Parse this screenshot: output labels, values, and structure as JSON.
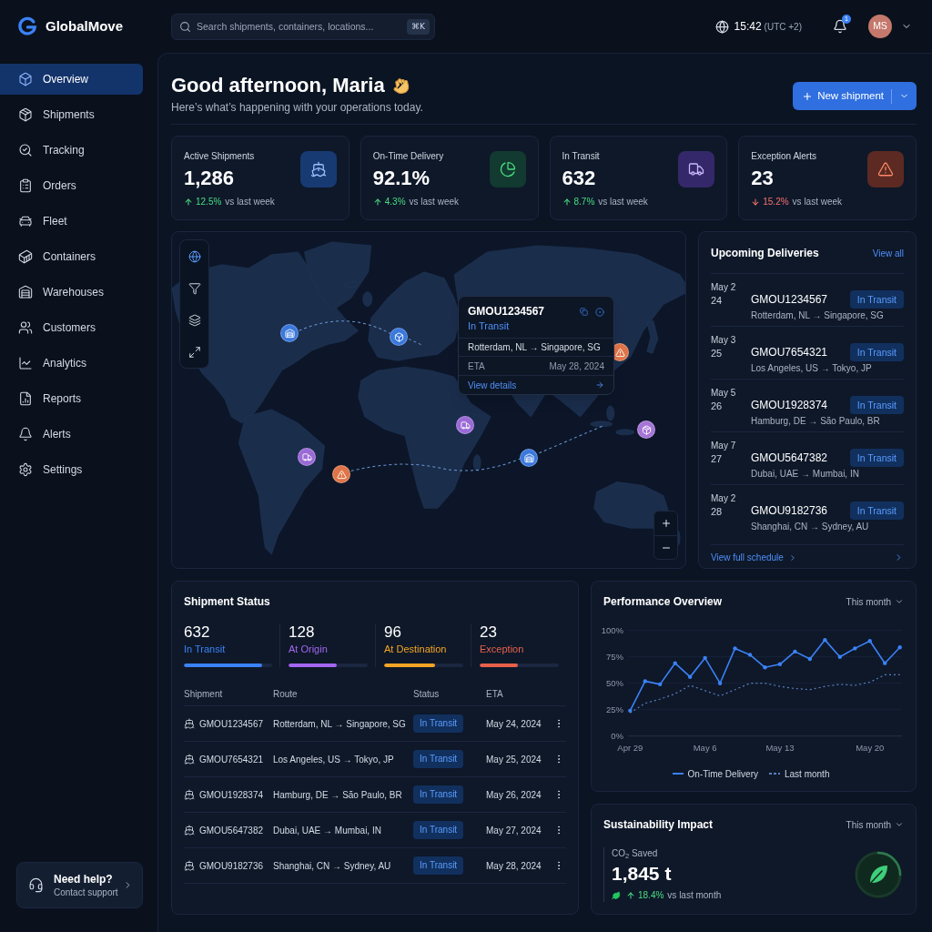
{
  "brand": {
    "name": "GlobalMove"
  },
  "search": {
    "placeholder": "Search shipments, containers, locations...",
    "shortcut": "⌘K"
  },
  "clock": {
    "time": "15:42",
    "zone": "(UTC +2)"
  },
  "notifications": {
    "count": "1"
  },
  "user": {
    "initials": "MS"
  },
  "sidebar": {
    "items": [
      {
        "label": "Overview",
        "selected": true
      },
      {
        "label": "Shipments",
        "selected": false
      },
      {
        "label": "Tracking",
        "selected": false
      },
      {
        "label": "Orders",
        "selected": false
      },
      {
        "label": "Fleet",
        "selected": false
      },
      {
        "label": "Containers",
        "selected": false
      },
      {
        "label": "Warehouses",
        "selected": false
      },
      {
        "label": "Customers",
        "selected": false
      },
      {
        "label": "Analytics",
        "selected": false
      },
      {
        "label": "Reports",
        "selected": false
      },
      {
        "label": "Alerts",
        "selected": false
      },
      {
        "label": "Settings",
        "selected": false
      }
    ],
    "help": {
      "title": "Need help?",
      "subtitle": "Contact support"
    }
  },
  "greeting": {
    "title": "Good afternoon, Maria",
    "subtitle": "Here’s what’s happening with your operations today."
  },
  "primary_action": {
    "label": "New shipment"
  },
  "kpis": [
    {
      "kind": "shipments",
      "label": "Active Shipments",
      "value": "1,286",
      "positive": true,
      "change": "12.5%",
      "note": "vs last week"
    },
    {
      "kind": "ontime",
      "label": "On-Time Delivery",
      "value": "92.1%",
      "positive": true,
      "change": "4.3%",
      "note": "vs last week"
    },
    {
      "kind": "transit",
      "label": "In Transit",
      "value": "632",
      "positive": true,
      "change": "8.7%",
      "note": "vs last week"
    },
    {
      "kind": "alert",
      "label": "Exception Alerts",
      "value": "23",
      "positive": false,
      "change": "15.2%",
      "note": "vs last week"
    }
  ],
  "map": {
    "tools": [
      {
        "selected": true
      },
      {
        "selected": false
      },
      {
        "selected": false
      },
      {
        "selected": false
      }
    ],
    "popup": {
      "id": "GMOU1234567",
      "status": "In Transit",
      "route": "Rotterdam, NL → Singapore, SG",
      "eta_label": "ETA",
      "eta": "May 28, 2024",
      "link": "View details"
    }
  },
  "upcoming": {
    "title": "Upcoming Deliveries",
    "link": "View all",
    "items": [
      {
        "month": "May 2",
        "day": "24",
        "id": "GMOU1234567",
        "route": "Rotterdam, NL → Singapore, SG",
        "status": "In Transit"
      },
      {
        "month": "May 3",
        "day": "25",
        "id": "GMOU7654321",
        "route": "Los Angeles, US → Tokyo, JP",
        "status": "In Transit"
      },
      {
        "month": "May 5",
        "day": "26",
        "id": "GMOU1928374",
        "route": "Hamburg, DE → São Paulo, BR",
        "status": "In Transit"
      },
      {
        "month": "May 7",
        "day": "27",
        "id": "GMOU5647382",
        "route": "Dubai, UAE → Mumbai, IN",
        "status": "In Transit"
      },
      {
        "month": "May 2",
        "day": "28",
        "id": "GMOU9182736",
        "route": "Shanghai, CN → Sydney, AU",
        "status": "In Transit"
      }
    ],
    "footer_link": "View full schedule"
  },
  "shipment_status": {
    "title": "Shipment Status",
    "stats": [
      {
        "value": "632",
        "label": "In Transit",
        "color": "#3b82f6",
        "level": 0.89
      },
      {
        "value": "128",
        "label": "At Origin",
        "color": "#a366f0",
        "level": 0.61
      },
      {
        "value": "96",
        "label": "At Destination",
        "color": "#f5a524",
        "level": 0.64
      },
      {
        "value": "23",
        "label": "Exception",
        "color": "#e8604a",
        "level": 0.48
      }
    ],
    "table": {
      "columns": [
        "Shipment",
        "Route",
        "Status",
        "ETA"
      ],
      "rows": [
        {
          "id": "GMOU1234567",
          "route": "Rotterdam, NL → Singapore, SG",
          "status": "In Transit",
          "eta": "May 24, 2024"
        },
        {
          "id": "GMOU7654321",
          "route": "Los Angeles, US → Tokyo, JP",
          "status": "In Transit",
          "eta": "May 25, 2024"
        },
        {
          "id": "GMOU1928374",
          "route": "Hamburg, DE → São Paulo, BR",
          "status": "In Transit",
          "eta": "May 26, 2024"
        },
        {
          "id": "GMOU5647382",
          "route": "Dubai, UAE → Mumbai, IN",
          "status": "In Transit",
          "eta": "May 27, 2024"
        },
        {
          "id": "GMOU9182736",
          "route": "Shanghai, CN → Sydney, AU",
          "status": "In Transit",
          "eta": "May 28, 2024"
        }
      ]
    }
  },
  "performance": {
    "title": "Performance Overview",
    "period": "This month",
    "chart_data": {
      "type": "line",
      "categories": [
        "Apr 29",
        null,
        null,
        null,
        null,
        "May 6",
        null,
        null,
        null,
        null,
        "May 13",
        null,
        null,
        null,
        null,
        null,
        "May 20",
        null,
        null
      ],
      "series": [
        {
          "name": "On-Time Delivery",
          "color": "#3b82f6",
          "line_style": "solid",
          "values": [
            24,
            52,
            49,
            69,
            56,
            74,
            50,
            83,
            77,
            65,
            68,
            80,
            73,
            91,
            75,
            83,
            90,
            69,
            84
          ]
        },
        {
          "name": "Last month",
          "color": "#5b7fc0",
          "line_style": "dashed",
          "values": [
            22,
            31,
            35,
            40,
            48,
            43,
            38,
            44,
            50,
            50,
            47,
            45,
            44,
            47,
            49,
            48,
            51,
            58,
            58
          ]
        }
      ],
      "ylim": [
        0,
        100
      ],
      "yticks": [
        {
          "value": 0,
          "label": "0%"
        },
        {
          "value": 25,
          "label": "25%"
        },
        {
          "value": 50,
          "label": "50%"
        },
        {
          "value": 75,
          "label": "75%"
        },
        {
          "value": 100,
          "label": "100%"
        }
      ],
      "grid": true,
      "legend": "bottom"
    }
  },
  "sustainability": {
    "title": "Sustainability Impact",
    "period": "This month",
    "metric": "CO$_{2}$ Saved",
    "value": "1,845 t",
    "positive": true,
    "change": "18.4%",
    "note": "vs last month"
  }
}
